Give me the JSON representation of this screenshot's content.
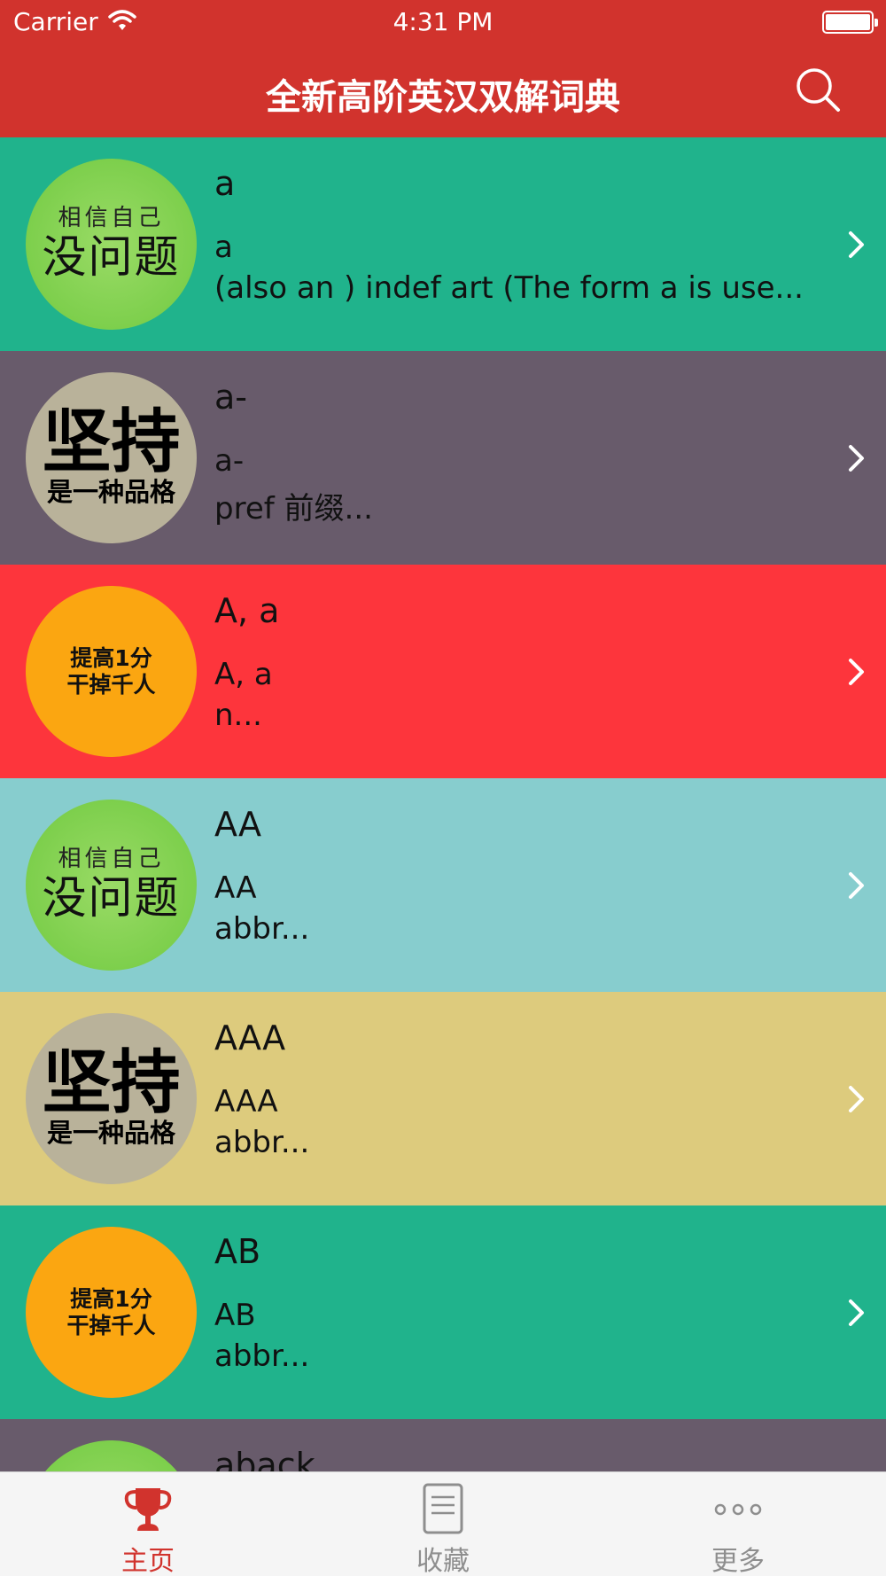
{
  "status": {
    "carrier": "Carrier",
    "time": "4:31 PM"
  },
  "nav": {
    "title": "全新高阶英汉双解词典",
    "search_icon": "search-icon"
  },
  "colors": {
    "brand_red": "#D1332D",
    "teal": "#20B38C",
    "purple_gray": "#685B6B",
    "red": "#FD353C",
    "light_blue": "#87CDCE",
    "sand": "#DDCB7D",
    "tab_active": "#D1332D",
    "tab_inactive": "#8E8E8E"
  },
  "avatars": {
    "green": {
      "top": "相信自己",
      "bottom": "没问题"
    },
    "gray": {
      "top": "坚持",
      "bottom": "是一种品格"
    },
    "orange": {
      "top": "提高1分",
      "bottom": "干掉千人"
    }
  },
  "entries": [
    {
      "word": "a",
      "headword": "a",
      "summary": "(also an ) indef art (The form a is use...",
      "color": "#20B38C",
      "avatar": "green"
    },
    {
      "word": "a-",
      "headword": "a-",
      "summary": "pref 前缀...",
      "color": "#685B6B",
      "avatar": "gray"
    },
    {
      "word": "A, a",
      "headword": "A, a",
      "summary": "n...",
      "color": "#FD353C",
      "avatar": "orange"
    },
    {
      "word": "AA",
      "headword": "AA",
      "summary": "abbr...",
      "color": "#87CDCE",
      "avatar": "green"
    },
    {
      "word": "AAA",
      "headword": "AAA",
      "summary": "abbr...",
      "color": "#DDCB7D",
      "avatar": "gray"
    },
    {
      "word": "AB",
      "headword": "AB",
      "summary": "abbr...",
      "color": "#20B38C",
      "avatar": "orange"
    },
    {
      "word": "aback",
      "headword": "",
      "summary": "",
      "color": "#685B6B",
      "avatar": "green"
    }
  ],
  "tabs": [
    {
      "label": "主页",
      "icon": "trophy-icon",
      "active": true
    },
    {
      "label": "收藏",
      "icon": "document-icon",
      "active": false
    },
    {
      "label": "更多",
      "icon": "more-dots-icon",
      "active": false
    }
  ]
}
